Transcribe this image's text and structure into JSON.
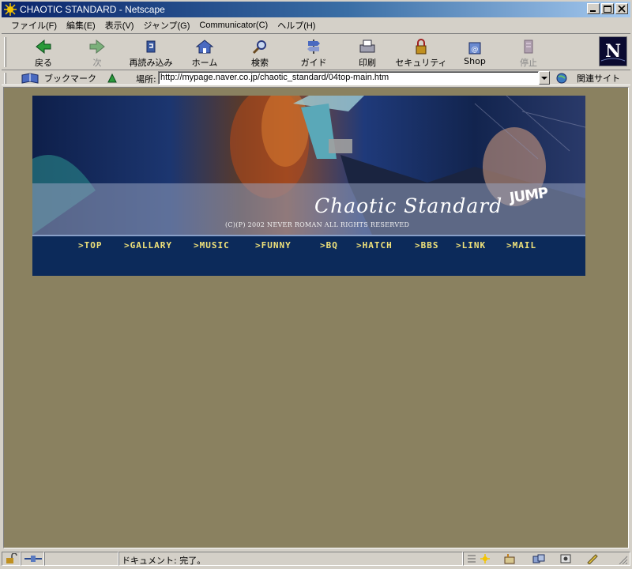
{
  "window": {
    "title": "CHAOTIC STANDARD - Netscape"
  },
  "menu": [
    "ファイル(F)",
    "編集(E)",
    "表示(V)",
    "ジャンプ(G)",
    "Communicator(C)",
    "ヘルプ(H)"
  ],
  "toolbar": {
    "back": "戻る",
    "forward": "次",
    "reload": "再読み込み",
    "home": "ホーム",
    "search": "検索",
    "guide": "ガイド",
    "print": "印刷",
    "security": "セキュリティ",
    "shop": "Shop",
    "stop": "停止"
  },
  "location": {
    "bookmarks_label": "ブックマーク",
    "label": "場所:",
    "url": "http://mypage.naver.co.jp/chaotic_standard/04top-main.htm",
    "related_label": "関連サイト"
  },
  "banner": {
    "title": "Chaotic Standard",
    "logo_text": "JUMP",
    "copyright": "(C)(P) 2002 NEVER ROMAN ALL RIGHTS RESERVED",
    "nav": [
      ">TOP",
      ">GALLARY",
      ">MUSIC",
      ">FUNNY",
      ">BQ",
      ">HATCH",
      ">BBS",
      ">LINK",
      ">MAIL"
    ]
  },
  "status": {
    "text": "ドキュメント: 完了。"
  },
  "colors": {
    "page_bg": "#8a8160",
    "nav_bg": "#0c2a5a",
    "nav_text": "#f0e27a",
    "titlebar": "#0a246a"
  }
}
